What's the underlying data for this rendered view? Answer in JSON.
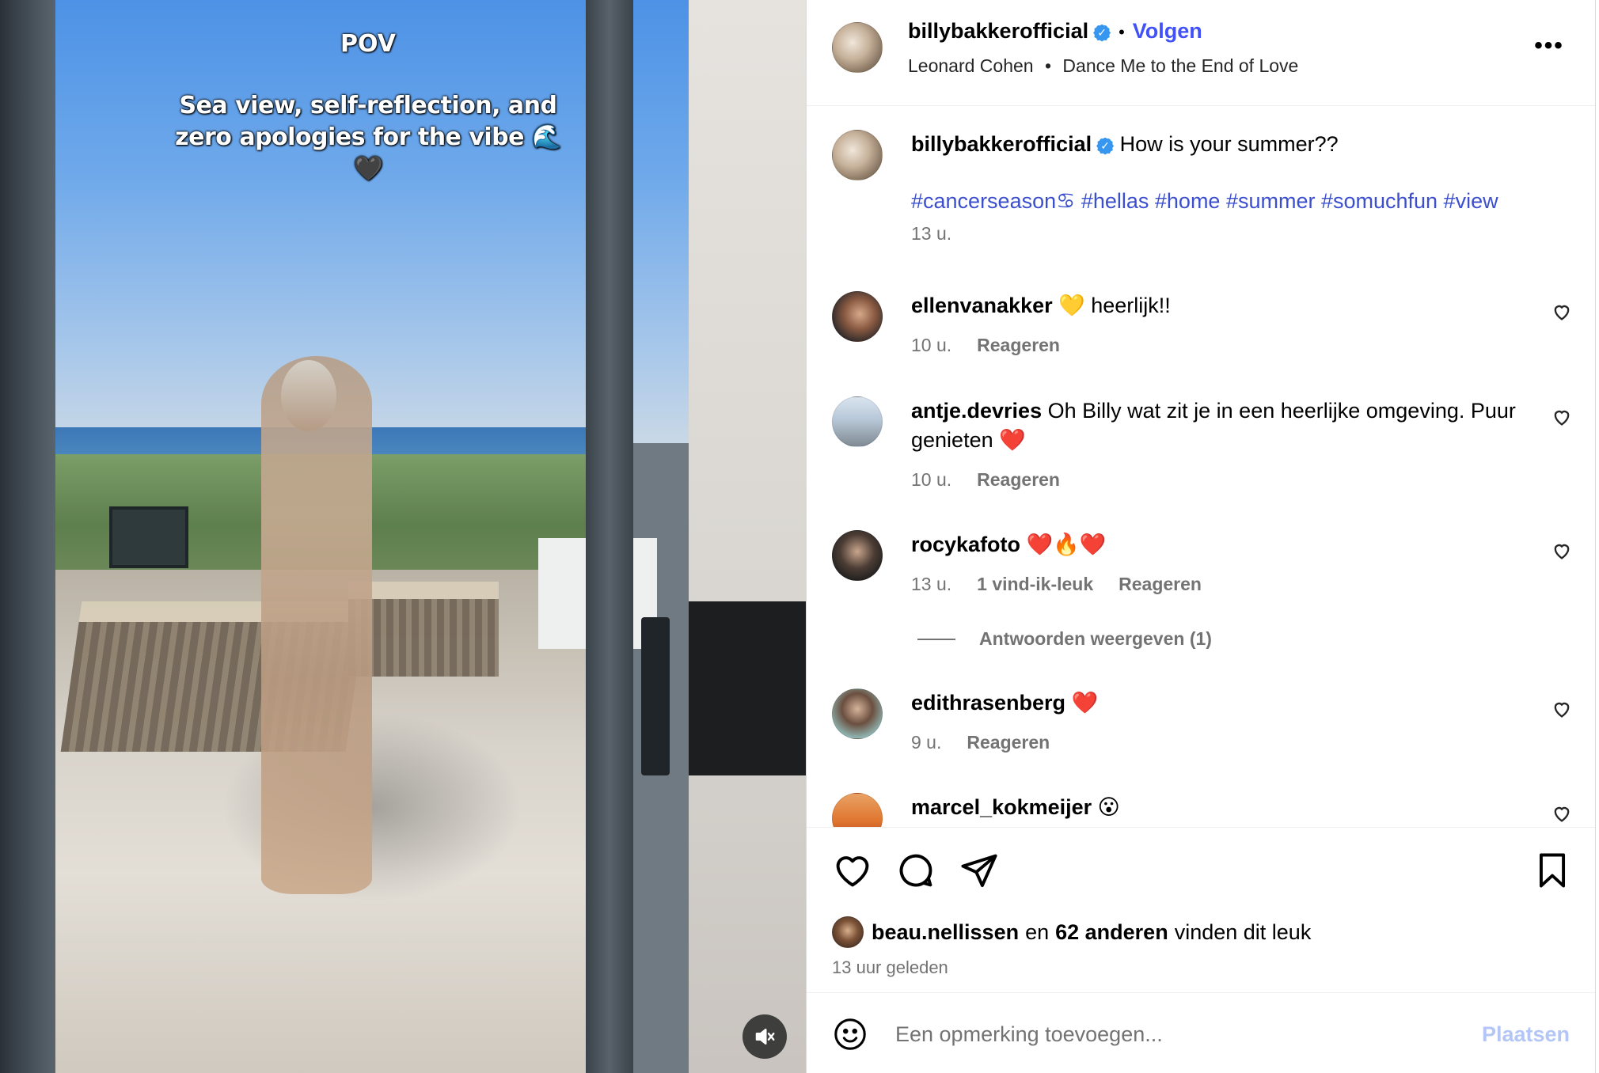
{
  "media": {
    "overlay_title": "POV",
    "overlay_caption": "Sea view, self-reflection, and zero apologies for the vibe 🌊🖤",
    "mute_icon": "speaker-muted-icon"
  },
  "header": {
    "username": "billybakkerofficial",
    "separator": "•",
    "follow_label": "Volgen",
    "artist": "Leonard Cohen",
    "song_separator": "•",
    "song": "Dance Me to the End of Love",
    "more_label": "•••"
  },
  "caption": {
    "username": "billybakkerofficial",
    "text": "How is your summer??",
    "hashtags": "#cancerseason♋ #hellas #home #summer #somuchfun #view",
    "time": "13 u."
  },
  "comments": [
    {
      "username": "ellenvanakker",
      "text": "💛 heerlijk!!",
      "time": "10 u.",
      "likes": "",
      "reply_label": "Reageren"
    },
    {
      "username": "antje.devries",
      "text": "Oh Billy wat zit je in een heerlijke omgeving. Puur genieten ❤️",
      "time": "10 u.",
      "likes": "",
      "reply_label": "Reageren"
    },
    {
      "username": "rocykafoto",
      "text": "❤️🔥❤️",
      "time": "13 u.",
      "likes": "1 vind-ik-leuk",
      "reply_label": "Reageren",
      "view_replies": "Antwoorden weergeven (1)"
    },
    {
      "username": "edithrasenberg",
      "text": "❤️",
      "time": "9 u.",
      "likes": "",
      "reply_label": "Reageren"
    },
    {
      "username": "marcel_kokmeijer",
      "text": "😮",
      "time": "",
      "likes": "",
      "reply_label": ""
    }
  ],
  "likes": {
    "first_liker": "beau.nellissen",
    "connector": "en",
    "others": "62 anderen",
    "suffix": "vinden dit leuk",
    "posted": "13 uur geleden"
  },
  "composer": {
    "placeholder": "Een opmerking toevoegen...",
    "post_label": "Plaatsen"
  },
  "colors": {
    "link_blue": "#4150f7",
    "hashtag_blue": "#3b4fce",
    "verified_blue": "#3797f0",
    "secondary_text": "#737373",
    "post_disabled": "#b3c6f5"
  }
}
